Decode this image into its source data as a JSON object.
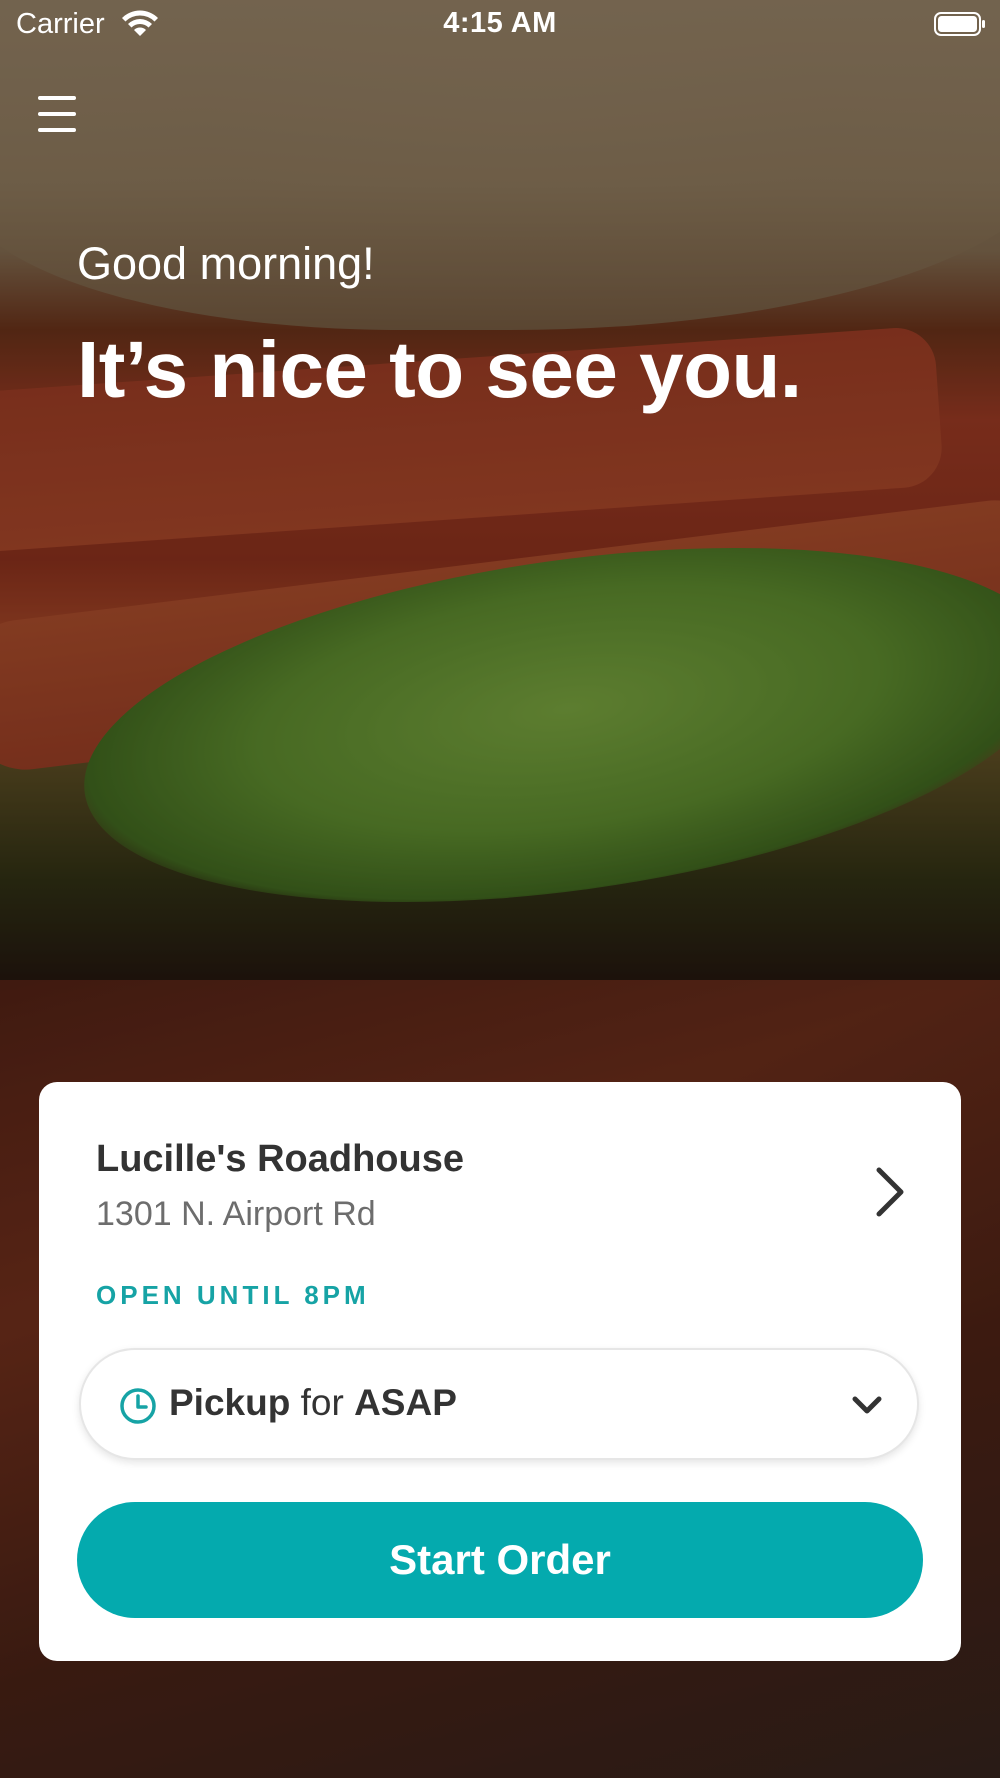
{
  "status_bar": {
    "carrier": "Carrier",
    "time": "4:15 AM"
  },
  "icons": {
    "menu": "hamburger-icon",
    "wifi": "wifi-icon",
    "battery": "battery-icon",
    "chevron_right": "chevron-right-icon",
    "clock": "clock-icon",
    "chevron_down": "chevron-down-icon"
  },
  "hero": {
    "greeting": "Good morning!",
    "headline": "It’s nice to see you."
  },
  "card": {
    "store_name": "Lucille's Roadhouse",
    "store_address": "1301 N. Airport Rd",
    "hours": "OPEN UNTIL 8PM",
    "pickup": {
      "mode": "Pickup",
      "connector": "for",
      "time": "ASAP"
    },
    "start_order_label": "Start Order"
  },
  "colors": {
    "accent": "#04aaae",
    "hours_text": "#16a3a5"
  }
}
